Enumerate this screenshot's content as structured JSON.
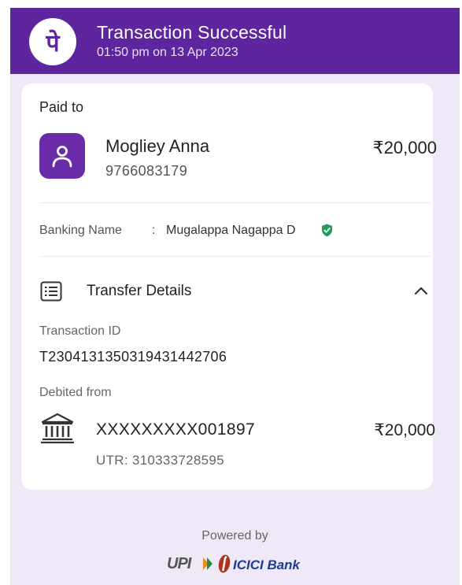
{
  "header": {
    "logo_glyph": "पे",
    "title": "Transaction Successful",
    "datetime": "01:50 pm on 13 Apr 2023",
    "background_color": "#5f259f"
  },
  "payment": {
    "paid_to_label": "Paid to",
    "payee_name": "Mogliey Anna",
    "payee_phone": "9766083179",
    "amount": "₹20,000",
    "banking_name_label": "Banking Name",
    "banking_name_separator": ":",
    "banking_name": "Mugalappa Nagappa D",
    "verified_icon": "verified-shield-icon"
  },
  "transfer_details": {
    "title": "Transfer Details",
    "transaction_id_label": "Transaction ID",
    "transaction_id": "T2304131350319431442706",
    "debited_from_label": "Debited from",
    "account_number": "XXXXXXXXX001897",
    "debit_amount": "₹20,000",
    "utr": "UTR: 310333728595"
  },
  "footer": {
    "powered_by": "Powered by",
    "upi_label": "UPI",
    "bank_label": "ICICI Bank"
  },
  "colors": {
    "accent": "#5f259f",
    "page_background": "#efe8f7",
    "verified": "#1e9e5a",
    "icici_blue": "#1a3d8f",
    "icici_orange": "#b5301c"
  }
}
